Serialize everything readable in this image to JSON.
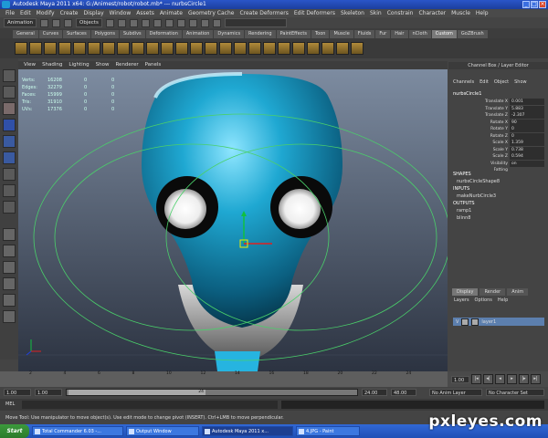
{
  "window": {
    "title": "Autodesk Maya 2011 x64: G:/Animest/robot/robot.mb*   ---   nurbsCircle1"
  },
  "menubar": [
    "File",
    "Edit",
    "Modify",
    "Create",
    "Display",
    "Window",
    "Assets",
    "Animate",
    "Geometry Cache",
    "Create Deformers",
    "Edit Deformers",
    "Skeleton",
    "Skin",
    "Constrain",
    "Character",
    "Muscle",
    "Help"
  ],
  "statusline": {
    "menuset": "Animation",
    "selection_mode": "Objects"
  },
  "shelf_tabs": [
    "General",
    "Curves",
    "Surfaces",
    "Polygons",
    "Subdivs",
    "Deformation",
    "Animation",
    "Dynamics",
    "Rendering",
    "PaintEffects",
    "Toon",
    "Muscle",
    "Fluids",
    "Fur",
    "Hair",
    "nCloth",
    "Custom",
    "GoZBrush"
  ],
  "shelf_active": "Custom",
  "viewport": {
    "menu": [
      "View",
      "Shading",
      "Lighting",
      "Show",
      "Renderer",
      "Panels"
    ],
    "hud": [
      {
        "label": "Verts:",
        "v1": "16208",
        "v2": "0",
        "v3": "0"
      },
      {
        "label": "Edges:",
        "v1": "32279",
        "v2": "0",
        "v3": "0"
      },
      {
        "label": "Faces:",
        "v1": "15999",
        "v2": "0",
        "v3": "0"
      },
      {
        "label": "Tris:",
        "v1": "31910",
        "v2": "0",
        "v3": "0"
      },
      {
        "label": "UVs:",
        "v1": "17376",
        "v2": "0",
        "v3": "0"
      }
    ]
  },
  "channel_box": {
    "title": "Channel Box / Layer Editor",
    "menu": [
      "Channels",
      "Edit",
      "Object",
      "Show"
    ],
    "object": "nurbsCircle1",
    "attributes": [
      {
        "name": "Translate X",
        "value": "0.001"
      },
      {
        "name": "Translate Y",
        "value": "5.883"
      },
      {
        "name": "Translate Z",
        "value": "-2.307"
      },
      {
        "name": "Rotate X",
        "value": "90"
      },
      {
        "name": "Rotate Y",
        "value": "0"
      },
      {
        "name": "Rotate Z",
        "value": "0"
      },
      {
        "name": "Scale X",
        "value": "1.359"
      },
      {
        "name": "Scale Y",
        "value": "0.738"
      },
      {
        "name": "Scale Z",
        "value": "0.594"
      },
      {
        "name": "Visibility",
        "value": "on"
      },
      {
        "name": "Fatting",
        "value": ""
      }
    ],
    "shapes_header": "SHAPES",
    "shape": "nurbsCircleShape8",
    "inputs_header": "INPUTS",
    "input": "makeNurbCircle3",
    "outputs_header": "OUTPUTS",
    "outputs": [
      "ramp1",
      "blinn8"
    ]
  },
  "layer_editor": {
    "tabs": [
      "Display",
      "Render",
      "Anim"
    ],
    "menu": [
      "Layers",
      "Options",
      "Help"
    ],
    "layer": {
      "visible": "V",
      "name": "layer1"
    }
  },
  "timeline": {
    "ticks": [
      "2",
      "4",
      "6",
      "8",
      "10",
      "12",
      "14",
      "16",
      "18",
      "20",
      "22",
      "24"
    ],
    "current_frame": "1.00",
    "start": "1.00",
    "range_start": "1.00",
    "range_end": "24",
    "end": "24.00",
    "end2": "48.00",
    "anim_layer": "No Anim Layer",
    "character_set": "No Character Set"
  },
  "commandline": {
    "label": "MEL"
  },
  "helpline": "Move Tool: Use manipulator to move object(s). Use edit mode to change pivot (INSERT). Ctrl+LMB to move perpendicular.",
  "taskbar": {
    "start": "Start",
    "tasks": [
      {
        "label": "Total Commander 6.03 -...",
        "active": false
      },
      {
        "label": "Output Window",
        "active": false
      },
      {
        "label": "Autodesk Maya 2011 x...",
        "active": true
      },
      {
        "label": "4.JPG - Paint",
        "active": false
      }
    ]
  },
  "watermark": "pxleyes.com",
  "colors": {
    "head": "#1aa3c8",
    "selection_circle": "#4ad06a",
    "titlebar": "#1c3f9e"
  }
}
